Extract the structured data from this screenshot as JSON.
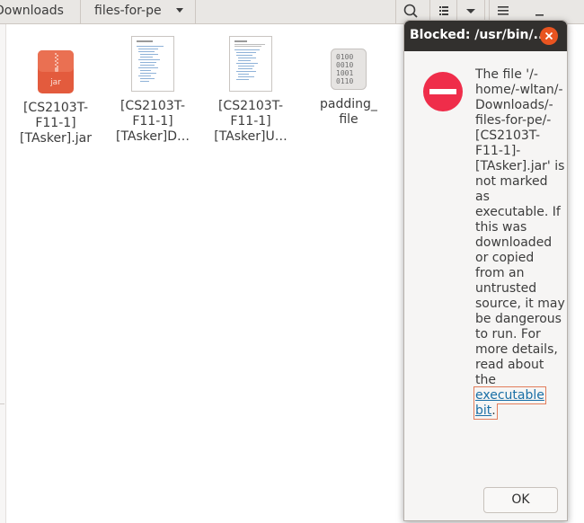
{
  "header": {
    "breadcrumbs": [
      "Downloads",
      "files-for-pe"
    ],
    "buttons": {
      "search": "search-icon",
      "list_view": "list-view-icon",
      "view_menu": "chevron-down-icon",
      "main_menu": "hamburger-menu-icon",
      "minimize": "minimize-icon"
    }
  },
  "files": [
    {
      "line1": "[CS2103T-",
      "line2": "F11-1]",
      "line3": "[TAsker].jar",
      "badge": "jar",
      "icon": "jar-archive-icon"
    },
    {
      "line1": "[CS2103T-",
      "line2": "F11-1]",
      "line3": "[TAsker]D…",
      "icon": "document-icon"
    },
    {
      "line1": "[CS2103T-",
      "line2": "F11-1]",
      "line3": "[TAsker]U…",
      "icon": "document-icon"
    },
    {
      "line1": "padding_",
      "line2": "file",
      "icon": "binary-file-icon"
    }
  ],
  "dialog": {
    "title": "Blocked: /usr/bin/...",
    "message_before_link": "The file '/-home/-wltan/-Downloads/-files-for-pe/-[CS2103T-F11-1]-[TAsker].jar' is not marked as executable. If this was downloaded or copied from an untrusted source, it may be dangerous to run.  For more details, read about the ",
    "link_text": "executable bit",
    "message_after_link": ".",
    "ok_label": "OK",
    "icon": "stop-icon"
  },
  "colors": {
    "titlebar": "#32302e",
    "close_button": "#e95420",
    "stop_icon": "#ef2d4a",
    "link": "#1a6fa6",
    "jar_icon": "#e35b3d"
  }
}
